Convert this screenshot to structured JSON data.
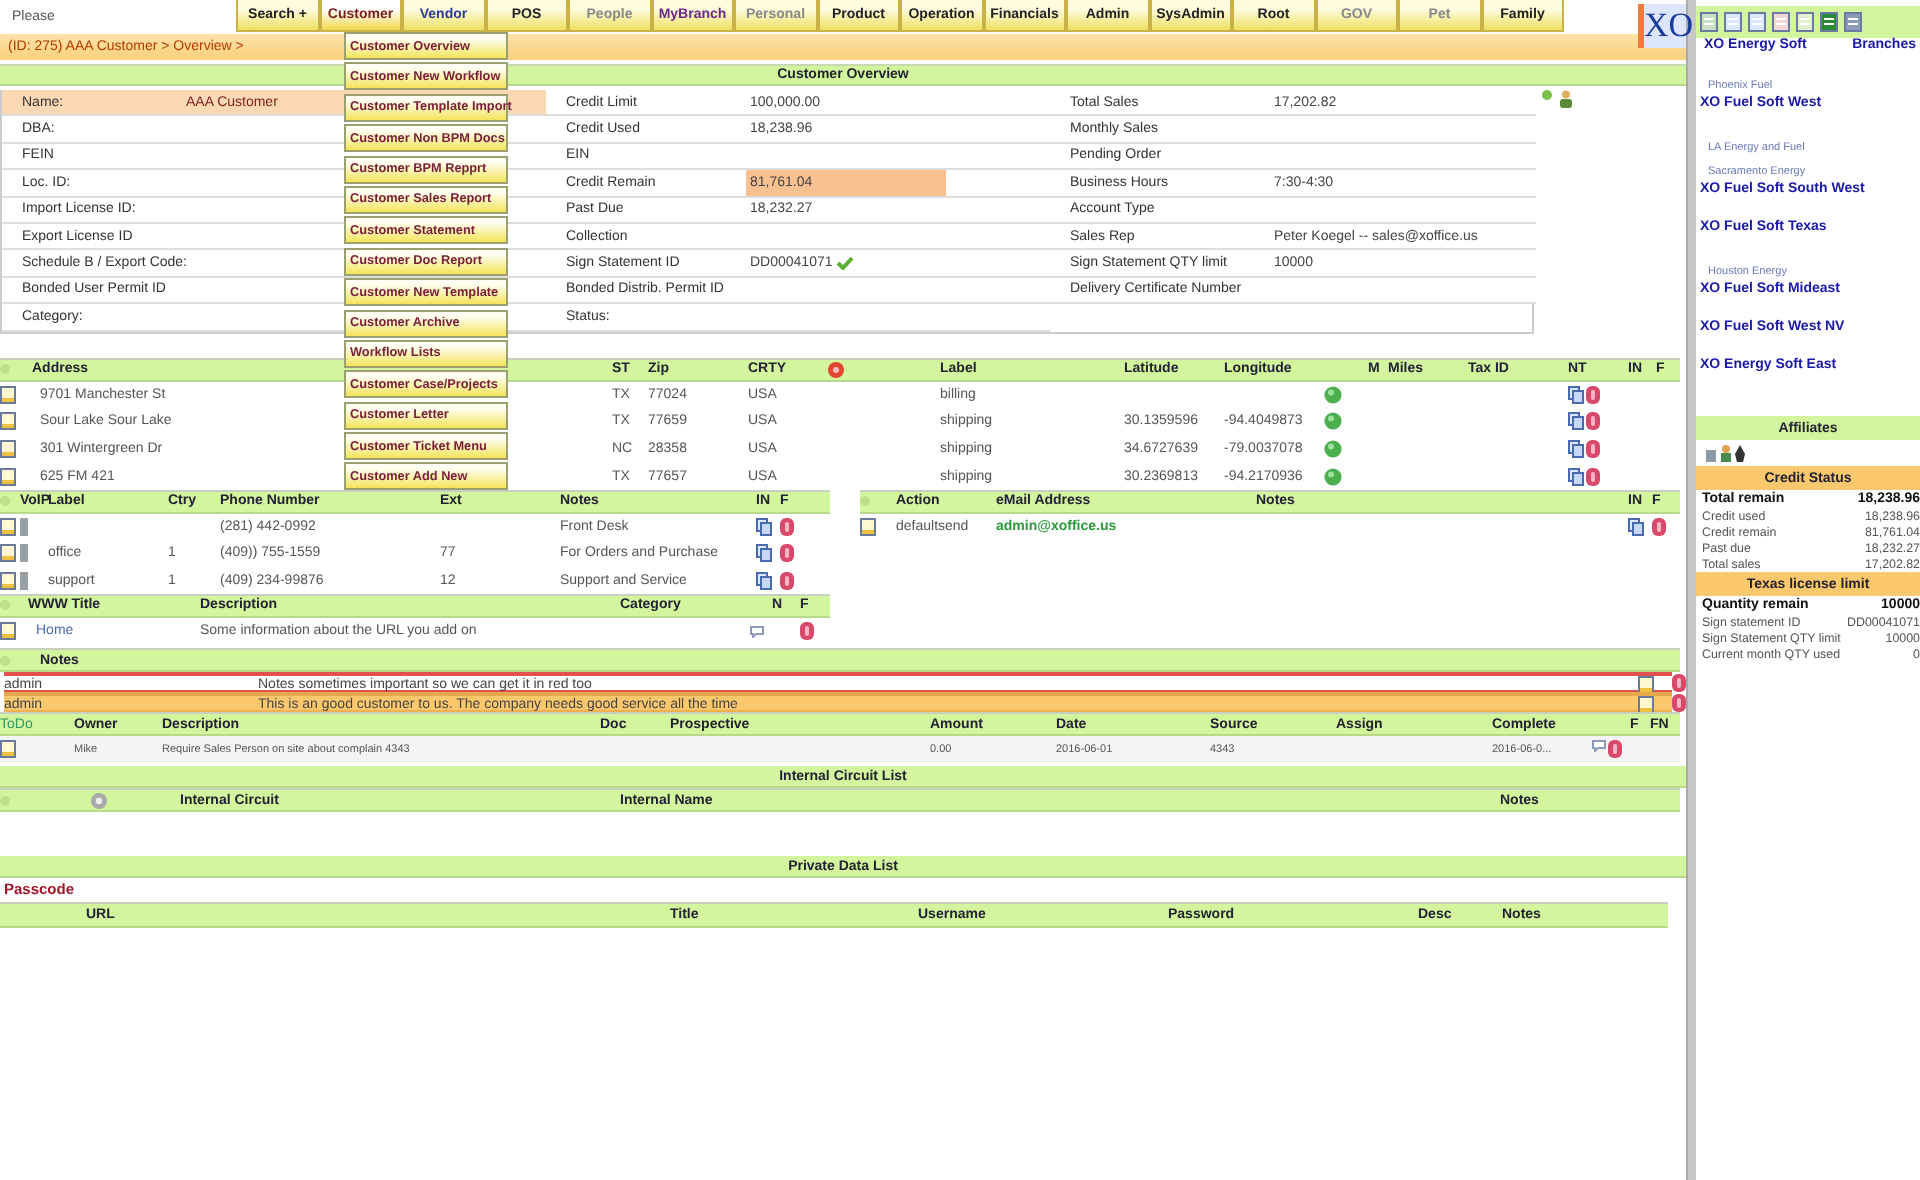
{
  "search": {
    "placeholder": "Please"
  },
  "nav_tabs": [
    {
      "label": "Search +",
      "color": "#222222",
      "selected": false
    },
    {
      "label": "Customer",
      "color": "#7a1f1f",
      "selected": true
    },
    {
      "label": "Vendor",
      "color": "#2a3c9a",
      "selected": false
    },
    {
      "label": "POS",
      "color": "#222222",
      "selected": false
    },
    {
      "label": "People",
      "color": "#888888",
      "selected": false
    },
    {
      "label": "MyBranch",
      "color": "#6a2a8a",
      "selected": false
    },
    {
      "label": "Personal",
      "color": "#888888",
      "selected": false
    },
    {
      "label": "Product",
      "color": "#222222",
      "selected": false
    },
    {
      "label": "Operation",
      "color": "#222222",
      "selected": false
    },
    {
      "label": "Financials",
      "color": "#222222",
      "selected": false
    },
    {
      "label": "Admin",
      "color": "#222222",
      "selected": false
    },
    {
      "label": "SysAdmin",
      "color": "#222222",
      "selected": false
    },
    {
      "label": "Root",
      "color": "#222222",
      "selected": false
    },
    {
      "label": "GOV",
      "color": "#888888",
      "selected": false
    },
    {
      "label": "Pet",
      "color": "#888888",
      "selected": false
    },
    {
      "label": "Family",
      "color": "#222222",
      "selected": false
    }
  ],
  "logo": {
    "text": "XO"
  },
  "breadcrumb": "(ID: 275) AAA Customer > Overview >",
  "customer_menu": [
    "Customer Overview",
    "Customer New Workflow",
    "Customer Template Import",
    "Customer Non BPM Docs",
    "Customer BPM Repprt",
    "Customer Sales Report",
    "Customer Statement",
    "Customer Doc Report",
    "Customer New Template",
    "Customer Archive",
    "Workflow Lists",
    "Customer Case/Projects",
    "Customer Letter",
    "Customer Ticket Menu",
    "Customer Add New"
  ],
  "overview": {
    "title": "Customer Overview",
    "rows": [
      [
        {
          "label": "Name:",
          "value": "AAA Customer",
          "highlight": true
        },
        {
          "label": "Credit Limit",
          "value": "100,000.00"
        },
        {
          "label": "Total Sales",
          "value": "17,202.82"
        }
      ],
      [
        {
          "label": "DBA:"
        },
        {
          "label": "Credit Used",
          "value": "18,238.96"
        },
        {
          "label": "Monthly Sales"
        }
      ],
      [
        {
          "label": "FEIN"
        },
        {
          "label": "EIN"
        },
        {
          "label": "Pending Order"
        }
      ],
      [
        {
          "label": "Loc. ID:"
        },
        {
          "label": "Credit Remain",
          "value": "81,761.04",
          "highlight": true
        },
        {
          "label": "Business Hours",
          "value": "7:30-4:30"
        }
      ],
      [
        {
          "label": "Import License ID:"
        },
        {
          "label": "Past Due",
          "value": "18,232.27"
        },
        {
          "label": "Account Type"
        }
      ],
      [
        {
          "label": "Export License ID"
        },
        {
          "label": "Collection"
        },
        {
          "label": "Sales Rep",
          "value": "Peter Koegel -- sales@xoffice.us"
        }
      ],
      [
        {
          "label": "Schedule B / Export Code:"
        },
        {
          "label": "Sign Statement ID",
          "value": "DD00041071",
          "verified": true
        },
        {
          "label": "Sign Statement QTY limit",
          "value": "10000"
        }
      ],
      [
        {
          "label": "Bonded User Permit ID"
        },
        {
          "label": "Bonded Distrib. Permit ID"
        },
        {
          "label": "Delivery Certificate Number"
        }
      ],
      [
        {
          "label": "Category:"
        },
        {
          "label": "Status:"
        }
      ]
    ]
  },
  "addresses": {
    "columns": [
      "Address",
      "ST",
      "Zip",
      "CRTY",
      "Label",
      "Latitude",
      "Longitude",
      "M",
      "Miles",
      "Tax ID",
      "NT",
      "IN",
      "F"
    ],
    "rows": [
      {
        "address": "9701 Manchester St",
        "st": "TX",
        "zip": "77024",
        "country": "USA",
        "label": "billing"
      },
      {
        "address": "Sour Lake Sour Lake",
        "st": "TX",
        "zip": "77659",
        "country": "USA",
        "label": "shipping",
        "latitude": "30.1359596",
        "longitude": "-94.4049873"
      },
      {
        "address": "301 Wintergreen Dr",
        "st": "NC",
        "zip": "28358",
        "country": "USA",
        "label": "shipping",
        "latitude": "34.6727639",
        "longitude": "-79.0037078"
      },
      {
        "address": "625 FM 421",
        "st": "TX",
        "zip": "77657",
        "country": "USA",
        "label": "shipping",
        "latitude": "30.2369813",
        "longitude": "-94.2170936"
      }
    ]
  },
  "phones": {
    "columns": [
      "VoIP",
      "Label",
      "Ctry",
      "Phone Number",
      "Ext",
      "Notes",
      "IN",
      "F"
    ],
    "rows": [
      {
        "phone": "(281) 442-0992",
        "notes": "Front Desk"
      },
      {
        "label": "office",
        "country": "1",
        "phone": "(409)) 755-1559",
        "ext": "77",
        "notes": "For Orders and Purchase"
      },
      {
        "label": "support",
        "country": "1",
        "phone": "(409) 234-99876",
        "ext": "12",
        "notes": "Support and Service"
      }
    ]
  },
  "emails": {
    "columns": [
      "Action",
      "eMail Address",
      "Notes",
      "IN",
      "F"
    ],
    "rows": [
      {
        "action": "defaultsend",
        "email": "admin@xoffice.us"
      }
    ]
  },
  "websites": {
    "columns": [
      "WWW Title",
      "Description",
      "Category",
      "N",
      "F"
    ],
    "rows": [
      {
        "title": "Home",
        "description": "Some information about the URL you add on"
      }
    ]
  },
  "notes": {
    "title": "Notes",
    "rows": [
      {
        "author": "admin",
        "text": "Notes sometimes important so we can get it in red too",
        "kind": "urgent"
      },
      {
        "author": "admin",
        "text": "This is an good customer to us. The company needs good service all the time",
        "kind": "info"
      }
    ]
  },
  "todos": {
    "columns": [
      "ToDo",
      "Owner",
      "Description",
      "Doc",
      "Prospective",
      "Amount",
      "Date",
      "Source",
      "Assign",
      "Complete",
      "F",
      "FN"
    ],
    "rows": [
      {
        "owner": "Mike",
        "description": "Require Sales Person on site about complain 4343",
        "amount": "0.00",
        "date": "2016-06-01",
        "source": "4343",
        "complete": "2016-06-0..."
      }
    ]
  },
  "internal_circuits": {
    "title": "Internal Circuit List",
    "columns": [
      "Internal Circuit",
      "Internal Name",
      "Notes"
    ]
  },
  "private_data": {
    "title": "Private Data List",
    "subtitle": "Passcode",
    "columns": [
      "URL",
      "Title",
      "Username",
      "Password",
      "Desc",
      "Notes"
    ]
  },
  "sidebar": {
    "branches_title": "Branches",
    "branches": [
      {
        "name": "XO Energy Soft",
        "kind": "branch"
      },
      {
        "name": "Phoenix Fuel",
        "kind": "group"
      },
      {
        "name": "XO Fuel Soft West",
        "kind": "branch"
      },
      {
        "name": "LA Energy and Fuel",
        "kind": "group"
      },
      {
        "name": "Sacramento Energy",
        "kind": "group"
      },
      {
        "name": "XO Fuel Soft South West",
        "kind": "branch"
      },
      {
        "name": "XO Fuel Soft Texas",
        "kind": "branch"
      },
      {
        "name": "Houston Energy",
        "kind": "group"
      },
      {
        "name": "XO Fuel Soft Mideast",
        "kind": "branch"
      },
      {
        "name": "XO Fuel Soft West NV",
        "kind": "branch"
      },
      {
        "name": "XO Energy Soft East",
        "kind": "branch"
      }
    ],
    "affiliates_title": "Affiliates",
    "credit_status": {
      "title": "Credit Status",
      "rows": [
        {
          "label": "Total remain",
          "value": "18,238.96",
          "kind": "total"
        },
        {
          "label": "Credit used",
          "value": "18,238.96",
          "kind": "detail"
        },
        {
          "label": "Credit remain",
          "value": "81,761.04",
          "kind": "detail"
        },
        {
          "label": "Past due",
          "value": "18,232.27",
          "kind": "detail"
        },
        {
          "label": "Total sales",
          "value": "17,202.82",
          "kind": "detail"
        }
      ]
    },
    "license": {
      "title": "Texas license limit",
      "rows": [
        {
          "label": "Quantity remain",
          "value": "10000",
          "kind": "total"
        },
        {
          "label": "Sign statement ID",
          "value": "DD00041071",
          "kind": "detail"
        },
        {
          "label": "Sign Statement QTY limit",
          "value": "10000",
          "kind": "detail"
        },
        {
          "label": "Current month QTY used",
          "value": "0",
          "kind": "detail"
        }
      ]
    }
  }
}
